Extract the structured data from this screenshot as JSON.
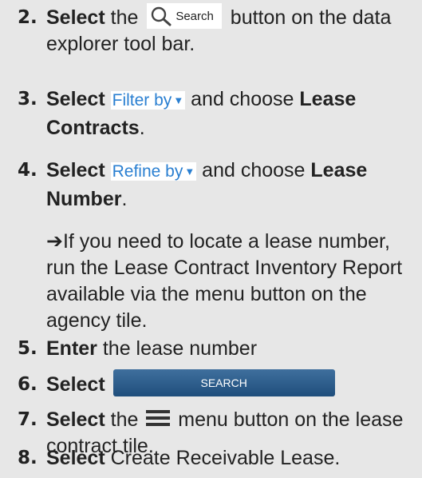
{
  "steps": [
    {
      "num": "2.",
      "verb": "Select",
      "pre": " the ",
      "ui_label": "Search",
      "post": " button on the data explorer tool bar."
    },
    {
      "num": "3.",
      "verb": "Select",
      "ui_label": "Filter by",
      "mid": " and choose ",
      "target": "Lease Contracts",
      "end": "."
    },
    {
      "num": "4.",
      "verb": "Select",
      "ui_label": "Refine by",
      "mid": " and choose ",
      "target": "Lease Number",
      "end": "."
    },
    {
      "num": "5.",
      "verb": "Enter",
      "rest": " the lease number"
    },
    {
      "num": "6.",
      "verb": "Select",
      "button_label": "SEARCH"
    },
    {
      "num": "7.",
      "verb": "Select",
      "pre": " the ",
      "post": " menu button on the lease contract tile."
    },
    {
      "num": "8.",
      "verb": "Select",
      "rest": " Create Receivable Lease."
    }
  ],
  "note": {
    "arrow": "➔",
    "text": "If you need to locate a lease number, run the Lease Contract Inventory Report available via the menu button on the agency tile."
  },
  "icons": {
    "search": "search-icon",
    "caret": "caret-down-icon",
    "menu": "hamburger-menu-icon"
  },
  "colors": {
    "background": "#e7e7e7",
    "link_blue": "#2a7fd1",
    "button_blue": "#2a5a88"
  }
}
